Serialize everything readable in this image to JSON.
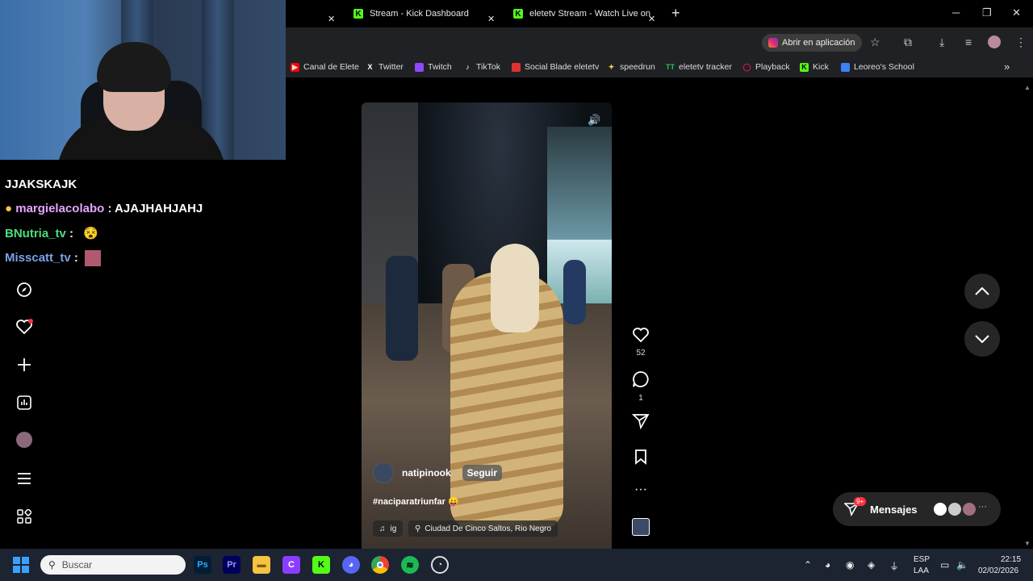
{
  "browser": {
    "tabs": [
      {
        "label": "Stream - Kick Dashboard"
      },
      {
        "label": "eletetv Stream - Watch Live on"
      }
    ],
    "new_tab": "+",
    "open_in_app": "Abrir en aplicación",
    "bookmarks": [
      {
        "label": "Canal de Elete",
        "icon": "youtube-icon",
        "color": "#ff0000"
      },
      {
        "label": "Twitter",
        "icon": "x-icon",
        "color": "#000000"
      },
      {
        "label": "Twitch",
        "icon": "twitch-icon",
        "color": "#9146ff"
      },
      {
        "label": "TikTok",
        "icon": "tiktok-icon",
        "color": "#000000"
      },
      {
        "label": "Social Blade eletetv",
        "icon": "socialblade-icon",
        "color": "#d33"
      },
      {
        "label": "speedrun",
        "icon": "speedrun-icon",
        "color": "#f2c94c"
      },
      {
        "label": "eletetv tracker",
        "icon": "tracker-icon",
        "color": "#22c55e"
      },
      {
        "label": "Playback",
        "icon": "playback-icon",
        "color": "#e11d48"
      },
      {
        "label": "Kick",
        "icon": "kick-icon",
        "color": "#53fc18"
      },
      {
        "label": "Leoreo's School",
        "icon": "school-icon",
        "color": "#3b82f6"
      }
    ],
    "more_bookmarks": "»"
  },
  "chat": {
    "partial_line": "JJAKSKAJK",
    "messages": [
      {
        "user": "margielacolabo",
        "text": ": AJAJHAHJAHJ",
        "color": "#e6a5ff"
      },
      {
        "user": "BNutria_tv",
        "text": ":",
        "color": "#4ade80"
      },
      {
        "user": "Misscatt_tv",
        "text": ":",
        "color": "#7aa2e8"
      }
    ]
  },
  "video": {
    "author": "natipinook",
    "follow_label": "Seguir",
    "hashtag": "#naciparatriunfar",
    "audio_label": "ig",
    "location": "Ciudad De Cinco Saltos, Rio Negro"
  },
  "actions": {
    "likes": "52",
    "comments": "1"
  },
  "messages": {
    "label": "Mensajes",
    "badge": "9+"
  },
  "taskbar": {
    "search_placeholder": "Buscar",
    "lang_line1": "ESP",
    "lang_line2": "LAA",
    "time": "22:15",
    "date": "02/02/2026"
  }
}
